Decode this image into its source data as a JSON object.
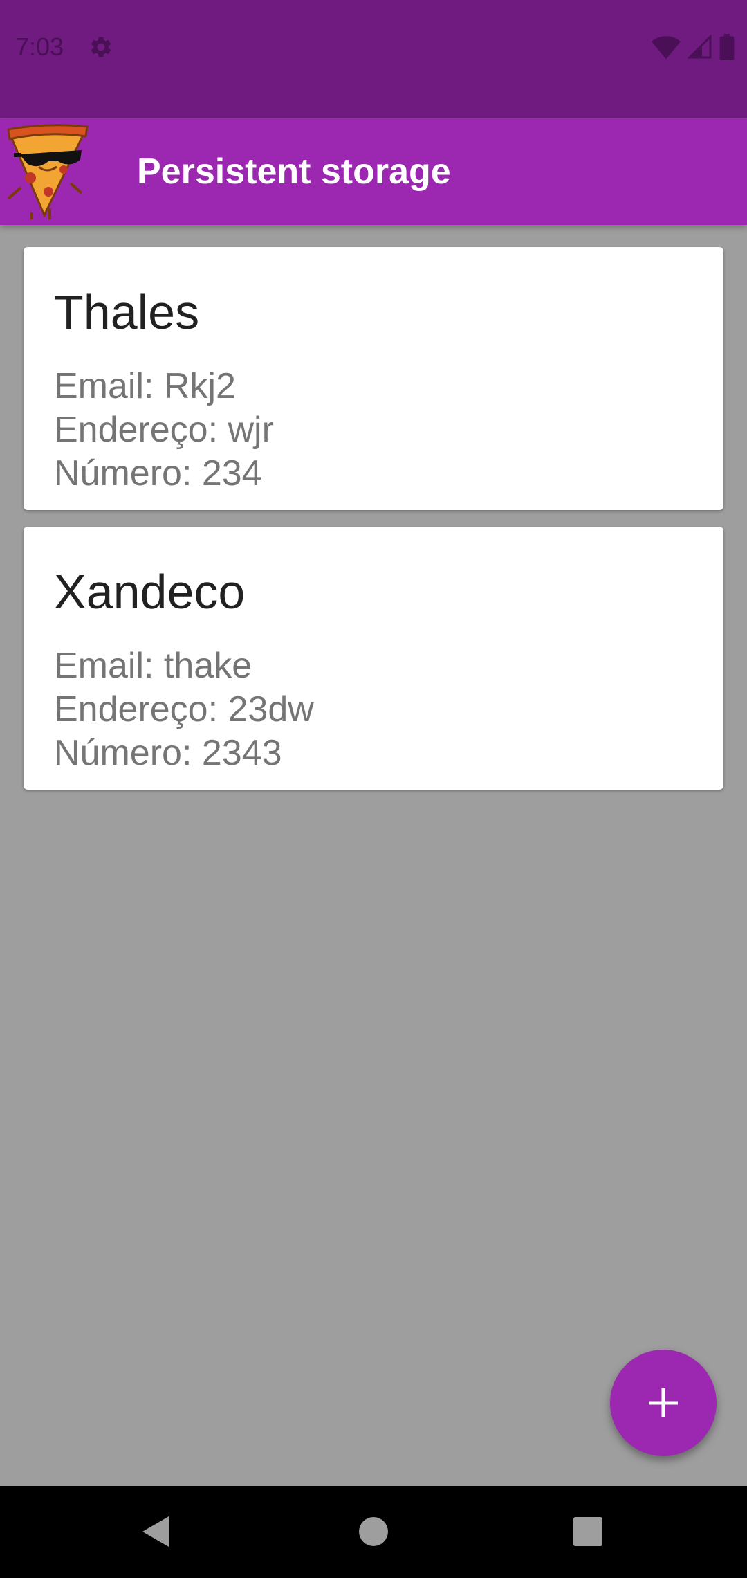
{
  "status_bar": {
    "time": "7:03",
    "icons": [
      "gear-icon",
      "wifi-icon",
      "signal-icon",
      "battery-icon"
    ]
  },
  "app_bar": {
    "title": "Persistent storage",
    "logo": "pizza-mascot-logo"
  },
  "contacts": [
    {
      "name": "Thales",
      "email": "Email: Rkj2",
      "address": "Endereço: wjr",
      "number": "Número: 234"
    },
    {
      "name": "Xandeco",
      "email": "Email: thake",
      "address": "Endereço: 23dw",
      "number": "Número: 2343"
    }
  ],
  "fab": {
    "icon": "plus-icon"
  },
  "nav_bar": {
    "icons": [
      "back-icon",
      "home-icon",
      "recents-icon"
    ]
  },
  "colors": {
    "status_bar": "#6f1b80",
    "app_bar": "#9c27b0",
    "background": "#9e9e9e",
    "card": "#ffffff",
    "fab": "#9c27b0"
  }
}
